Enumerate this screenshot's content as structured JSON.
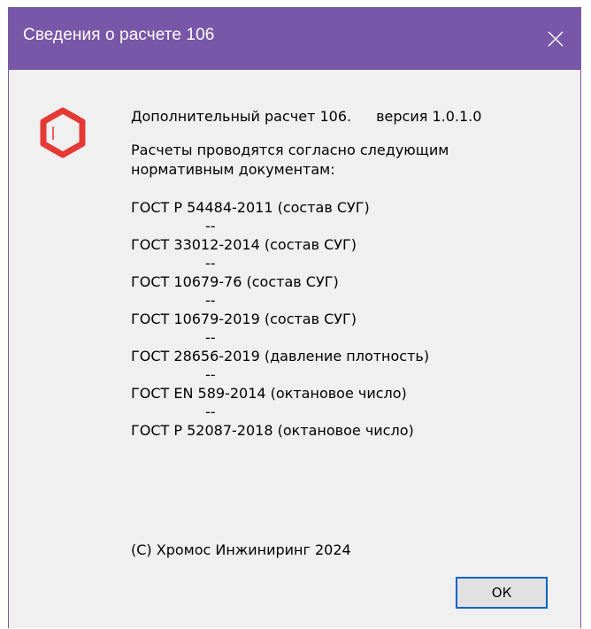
{
  "window": {
    "title": "Сведения о расчете 106"
  },
  "info": {
    "program": "Дополнительный расчет 106.",
    "version": "версия 1.0.1.0",
    "normatives_intro_line1": "Расчеты проводятся согласно следующим",
    "normatives_intro_line2": "нормативным документам:",
    "separator": "--",
    "gosts": [
      "ГОСТ Р 54484-2011 (состав СУГ)",
      "ГОСТ 33012-2014 (состав СУГ)",
      "ГОСТ 10679-76 (состав СУГ)",
      "ГОСТ 10679-2019 (состав СУГ)",
      "ГОСТ 28656-2019 (давление плотность)",
      "ГОСТ EN 589-2014 (октановое число)",
      "ГОСТ Р 52087-2018 (октановое число)"
    ],
    "copyright": "(C) Хромос Инжиниринг 2024"
  },
  "buttons": {
    "ok_label": "ОК"
  },
  "icons": {
    "close": "close-icon",
    "logo": "benzene-ring-icon"
  },
  "colors": {
    "titlebar": "#7957a8",
    "logo": "#e53935",
    "ok_border": "#0a64c8"
  }
}
